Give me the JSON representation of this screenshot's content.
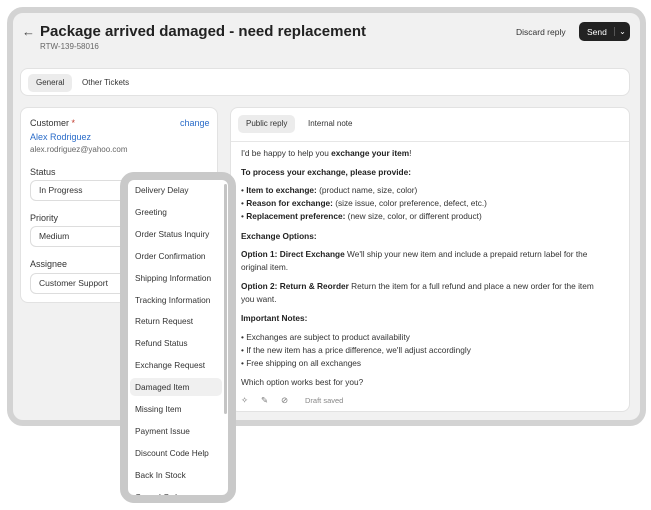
{
  "header": {
    "title": "Package arrived damaged - need replacement",
    "ticket_id": "RTW-139-58016",
    "discard_label": "Discard reply",
    "send_label": "Send"
  },
  "tabs": [
    {
      "label": "General",
      "active": true
    },
    {
      "label": "Other Tickets",
      "active": false
    }
  ],
  "customer": {
    "label": "Customer",
    "required": "*",
    "change_label": "change",
    "name": "Alex Rodriguez",
    "email": "alex.rodriguez@yahoo.com"
  },
  "fields": {
    "status_label": "Status",
    "status_value": "In Progress",
    "priority_label": "Priority",
    "priority_value": "Medium",
    "assignee_label": "Assignee",
    "assignee_value": "Customer Support"
  },
  "reply": {
    "tabs": [
      "Public reply",
      "Internal note"
    ],
    "intro": "I'd be happy to help you ",
    "intro_bold": "exchange your item",
    "intro_end": "!",
    "process_heading": "To process your exchange, please provide:",
    "items": [
      {
        "bold": "Item to exchange:",
        "text": " (product name, size, color)"
      },
      {
        "bold": "Reason for exchange:",
        "text": " (size issue, color preference, defect, etc.)"
      },
      {
        "bold": "Replacement preference:",
        "text": " (new size, color, or different product)"
      }
    ],
    "options_heading": "Exchange Options:",
    "option1_bold": "Option 1: Direct Exchange",
    "option1_text": " We'll ship your new item and include a prepaid return label for the",
    "option1_cont": "original item.",
    "option2_bold": "Option 2: Return & Reorder",
    "option2_text": " Return the item for a full refund and place a new order for the item",
    "option2_cont": "you want.",
    "notes_heading": "Important Notes:",
    "notes": [
      "Exchanges are subject to product availability",
      "If the new item has a price difference, we'll adjust accordingly",
      "Free shipping on all exchanges"
    ],
    "closing": "Which option works best for you?",
    "draft_status": "Draft saved"
  },
  "dropdown": {
    "highlighted": "Damaged Item",
    "items": [
      "Delivery Delay",
      "Greeting",
      "Order Status Inquiry",
      "Order Confirmation",
      "Shipping Information",
      "Tracking Information",
      "Return Request",
      "Refund Status",
      "Exchange Request",
      "Damaged Item",
      "Missing Item",
      "Payment Issue",
      "Discount Code Help",
      "Back In Stock",
      "Cancel Order"
    ]
  },
  "colors": {
    "link": "#2a6cc9",
    "send_bg": "#222222",
    "required": "#c0392b"
  }
}
